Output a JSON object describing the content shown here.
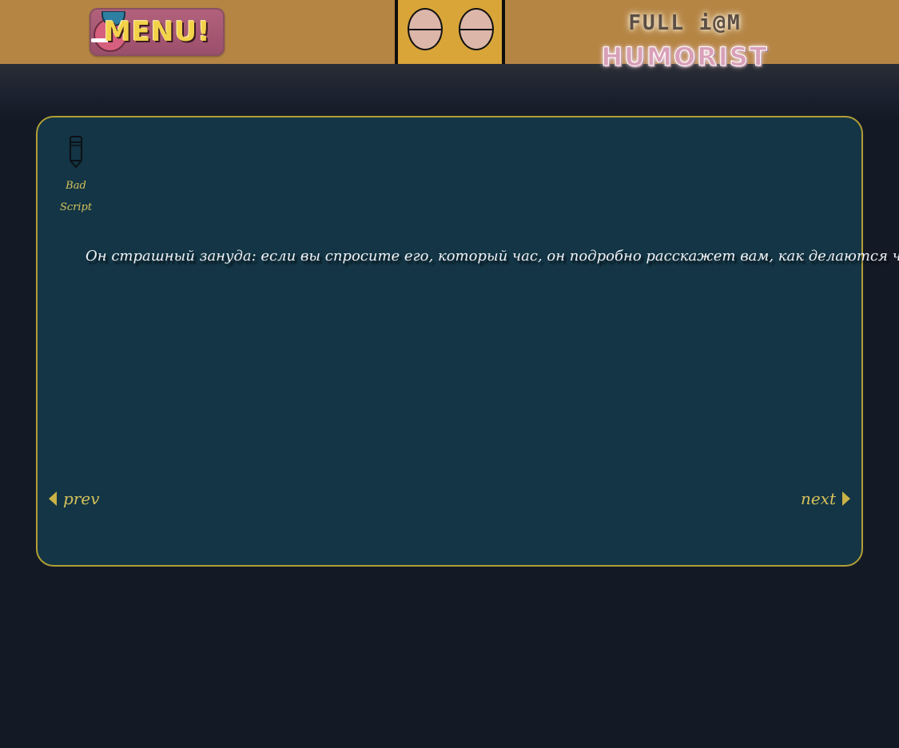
{
  "header": {
    "menu_label": "MENU!",
    "brand_line1": "FULL i@M",
    "brand_line2": "HUMORIST"
  },
  "font_picker": {
    "icon": "pencil-icon",
    "font_name": "Bad Script"
  },
  "joke": {
    "text": "Он страшный зануда: если вы спросите его, который час, он подробно расскажет вам, как делаются часы."
  },
  "navigation": {
    "prev_label": "prev",
    "next_label": "next"
  },
  "colors": {
    "topbar": "#b58544",
    "card_background": "#133545",
    "card_border": "#b39e35",
    "accent_text": "#d6c25b",
    "page_background": "#131a26"
  }
}
